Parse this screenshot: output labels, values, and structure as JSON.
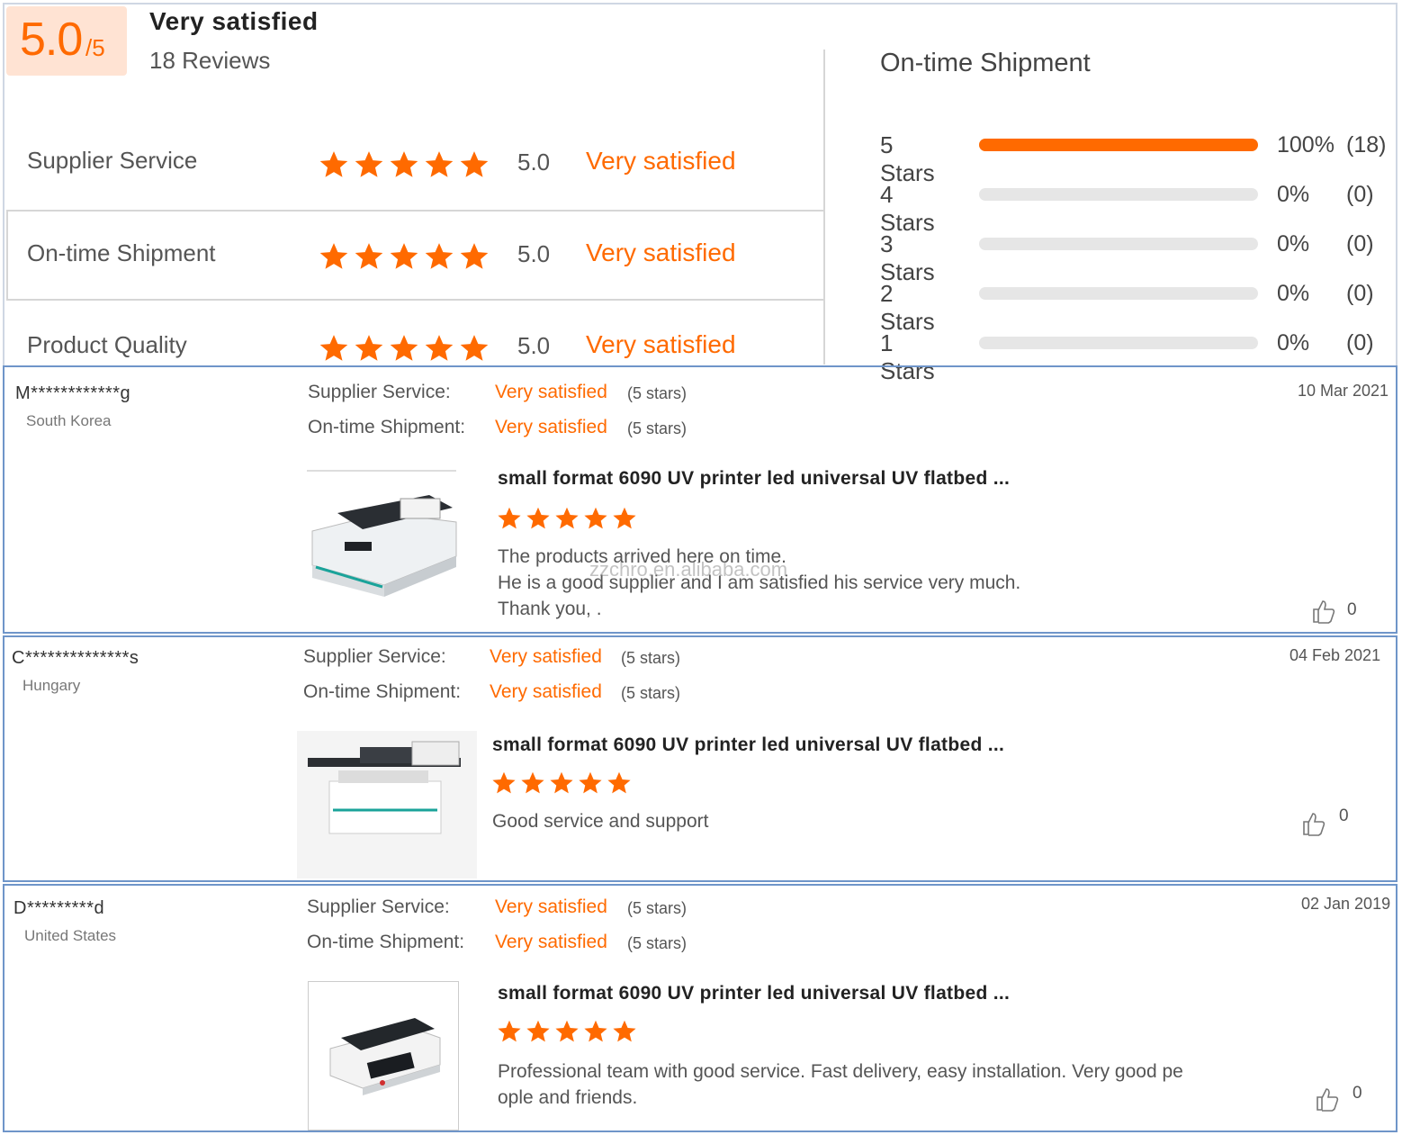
{
  "summary": {
    "score": "5.0",
    "score_max": "/5",
    "title": "Very satisfied",
    "review_count": "18 Reviews",
    "categories": [
      {
        "label": "Supplier Service",
        "rating": 5,
        "score": "5.0",
        "text": "Very satisfied"
      },
      {
        "label": "On-time Shipment",
        "rating": 5,
        "score": "5.0",
        "text": "Very satisfied"
      },
      {
        "label": "Product Quality",
        "rating": 5,
        "score": "5.0",
        "text": "Very satisfied"
      }
    ]
  },
  "histogram": {
    "title": "On-time Shipment",
    "rows": [
      {
        "label": "5  Stars",
        "fraction": 1.0,
        "pct": "100%",
        "count": "(18)"
      },
      {
        "label": "4  Stars",
        "fraction": 0,
        "pct": "0%",
        "count": "(0)"
      },
      {
        "label": "3  Stars",
        "fraction": 0,
        "pct": "0%",
        "count": "(0)"
      },
      {
        "label": "2  Stars",
        "fraction": 0,
        "pct": "0%",
        "count": "(0)"
      },
      {
        "label": "1  Stars",
        "fraction": 0,
        "pct": "0%",
        "count": "(0)"
      }
    ]
  },
  "reviews": [
    {
      "user": "M************g",
      "country": "South Korea",
      "date": "10 Mar 2021",
      "supplier_label": "Supplier Service:",
      "supplier_value": "Very satisfied",
      "supplier_stars": "(5 stars)",
      "shipment_label": "On-time Shipment:",
      "shipment_value": "Very satisfied",
      "shipment_stars": "(5 stars)",
      "product": "small format 6090 UV printer led universal UV flatbed ...",
      "rating": 5,
      "comment": [
        "The products arrived here on time.",
        "He is a good supplier and I am satisfied his service very much.",
        "Thank you, ."
      ],
      "likes": "0"
    },
    {
      "user": "C**************s",
      "country": "Hungary",
      "date": "04 Feb 2021",
      "supplier_label": "Supplier Service:",
      "supplier_value": "Very satisfied",
      "supplier_stars": "(5 stars)",
      "shipment_label": "On-time Shipment:",
      "shipment_value": "Very satisfied",
      "shipment_stars": "(5 stars)",
      "product": "small format 6090 UV printer led universal UV flatbed ...",
      "rating": 5,
      "comment": [
        "Good service and support"
      ],
      "likes": "0"
    },
    {
      "user": "D*********d",
      "country": "United States",
      "date": "02 Jan 2019",
      "supplier_label": "Supplier Service:",
      "supplier_value": "Very satisfied",
      "supplier_stars": "(5 stars)",
      "shipment_label": "On-time Shipment:",
      "shipment_value": "Very satisfied",
      "shipment_stars": "(5 stars)",
      "product": "small format 6090 UV printer led universal UV flatbed ...",
      "rating": 5,
      "comment": [
        "Professional team with good service. Fast delivery, easy installation. Very good pe",
        "ople and friends."
      ],
      "likes": "0"
    }
  ],
  "watermark": "zzchro.en.alibaba.com",
  "colors": {
    "accent": "#ff6a00",
    "score_bg": "#ffe3d3",
    "border": "#6f95c9",
    "bar_empty": "#e6e6e6"
  },
  "icons": [
    "star-icon",
    "thumbs-up-icon"
  ]
}
